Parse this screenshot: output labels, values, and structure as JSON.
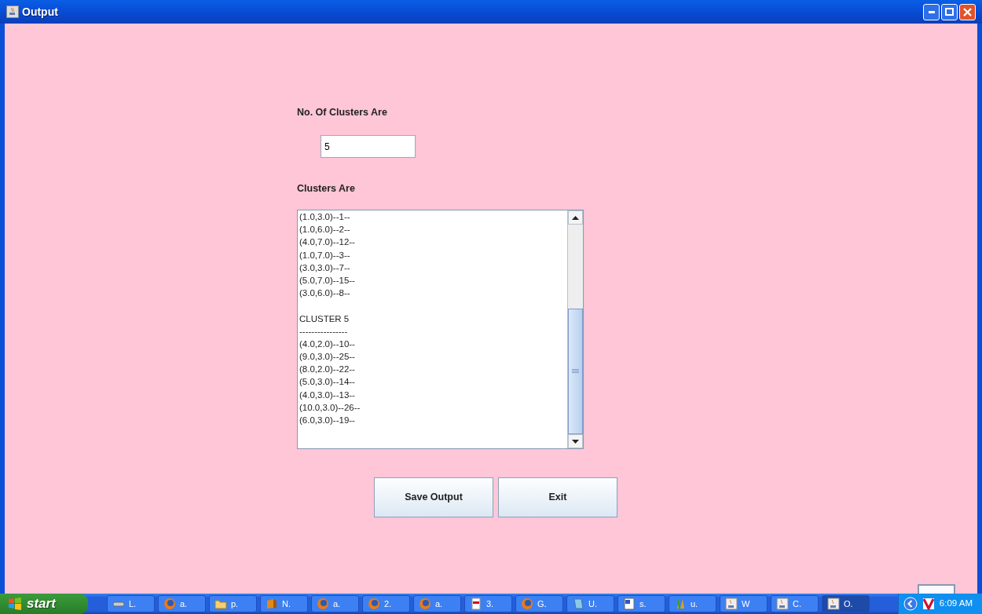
{
  "window": {
    "title": "Output"
  },
  "clusters_count": {
    "label": "No. Of Clusters Are",
    "value": "5"
  },
  "clusters": {
    "label": "Clusters Are",
    "blocks": [
      {
        "lines": [
          "(1.0,3.0)--1--",
          "(1.0,6.0)--2--",
          "(4.0,7.0)--12--",
          "(1.0,7.0)--3--",
          "(3.0,3.0)--7--",
          "(5.0,7.0)--15--",
          "(3.0,6.0)--8--"
        ]
      },
      {
        "heading": "CLUSTER 5",
        "rule": "----------------",
        "lines": [
          "(4.0,2.0)--10--",
          "(9.0,3.0)--25--",
          "(8.0,2.0)--22--",
          "(5.0,3.0)--14--",
          "(4.0,3.0)--13--",
          "(10.0,3.0)--26--",
          "(6.0,3.0)--19--"
        ]
      }
    ]
  },
  "buttons": [
    "Save Output",
    "Exit"
  ],
  "taskbar": {
    "start": "start",
    "items": [
      {
        "kind": "drive",
        "label": "L.",
        "selected": false
      },
      {
        "kind": "browser",
        "label": "a.",
        "selected": false
      },
      {
        "kind": "folder",
        "label": "p.",
        "selected": false
      },
      {
        "kind": "box",
        "label": "N.",
        "selected": false
      },
      {
        "kind": "browser",
        "label": "a.",
        "selected": false
      },
      {
        "kind": "browser",
        "label": "2.",
        "selected": false
      },
      {
        "kind": "browser",
        "label": "a.",
        "selected": false
      },
      {
        "kind": "pdf",
        "label": "3.",
        "selected": false
      },
      {
        "kind": "browser",
        "label": "G.",
        "selected": false
      },
      {
        "kind": "notepad",
        "label": "U.",
        "selected": false
      },
      {
        "kind": "doc",
        "label": "s.",
        "selected": false
      },
      {
        "kind": "paint",
        "label": "u.",
        "selected": false
      },
      {
        "kind": "java",
        "label": "W",
        "selected": false
      },
      {
        "kind": "java",
        "label": "C.",
        "selected": false
      },
      {
        "kind": "java",
        "label": "O.",
        "selected": true
      }
    ],
    "clock": "6:09 AM"
  }
}
